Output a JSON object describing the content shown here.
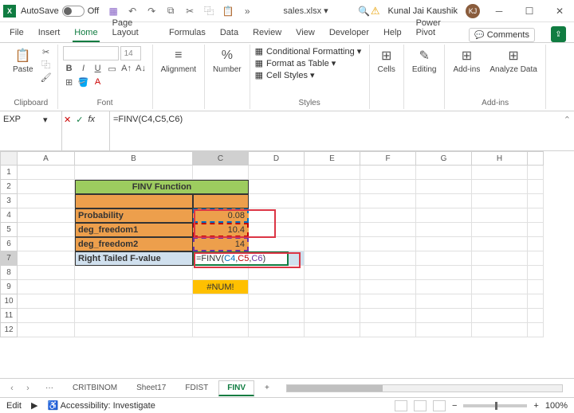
{
  "title": {
    "autosave": "AutoSave",
    "autosave_state": "Off",
    "filename": "sales.xlsx ▾",
    "user": "Kunal Jai Kaushik",
    "initials": "KJ"
  },
  "menu": {
    "file": "File",
    "insert": "Insert",
    "home": "Home",
    "page_layout": "Page Layout",
    "formulas": "Formulas",
    "data": "Data",
    "review": "Review",
    "view": "View",
    "developer": "Developer",
    "help": "Help",
    "power_pivot": "Power Pivot",
    "comments": "Comments"
  },
  "ribbon": {
    "clipboard": "Clipboard",
    "paste": "Paste",
    "font": "Font",
    "font_size": "14",
    "B": "B",
    "I": "I",
    "U": "U",
    "alignment": "Alignment",
    "number": "Number",
    "percent": "%",
    "styles": "Styles",
    "cond_fmt": "Conditional Formatting ▾",
    "fmt_table": "Format as Table ▾",
    "cell_styles": "Cell Styles ▾",
    "cells": "Cells",
    "editing": "Editing",
    "addins_lbl": "Add-ins",
    "addins": "Add-ins",
    "analyze": "Analyze Data"
  },
  "formula": {
    "name_box": "EXP",
    "fx": "fx",
    "value": "=FINV(C4,C5,C6)"
  },
  "cols": {
    "A": "A",
    "B": "B",
    "C": "C",
    "D": "D",
    "E": "E",
    "F": "F",
    "G": "G",
    "H": "H"
  },
  "rows": {
    "r1": "1",
    "r2": "2",
    "r3": "3",
    "r4": "4",
    "r5": "5",
    "r6": "6",
    "r7": "7",
    "r8": "8",
    "r9": "9",
    "r10": "10",
    "r11": "11",
    "r12": "12"
  },
  "sheet": {
    "title": "FINV Function",
    "r4b": "Probability",
    "r4c": "0.08",
    "r5b": "deg_freedom1",
    "r5c": "10.4",
    "r6b": "deg_freedom2",
    "r6c": "14",
    "r7b": "Right Tailed F-value",
    "r7c_prefix": "=FINV(",
    "r7c_a1": "C4",
    "r7c_a2": "C5",
    "r7c_a3": "C6",
    "r7c_sep": ",",
    "r7c_suffix": ")",
    "r9c": "#NUM!"
  },
  "tabs": {
    "dots": "···",
    "t1": "CRITBINOM",
    "t2": "Sheet17",
    "t3": "FDIST",
    "t4": "FINV",
    "plus": "+"
  },
  "status": {
    "mode": "Edit",
    "access": "Accessibility: Investigate",
    "zoom": "100%",
    "minus": "−",
    "plus": "+"
  },
  "chart_data": {
    "type": "table",
    "title": "FINV Function",
    "rows": [
      {
        "label": "Probability",
        "value": 0.08
      },
      {
        "label": "deg_freedom1",
        "value": 10.4
      },
      {
        "label": "deg_freedom2",
        "value": 14
      },
      {
        "label": "Right Tailed F-value",
        "value": "=FINV(C4,C5,C6)"
      }
    ],
    "result": "#NUM!"
  }
}
